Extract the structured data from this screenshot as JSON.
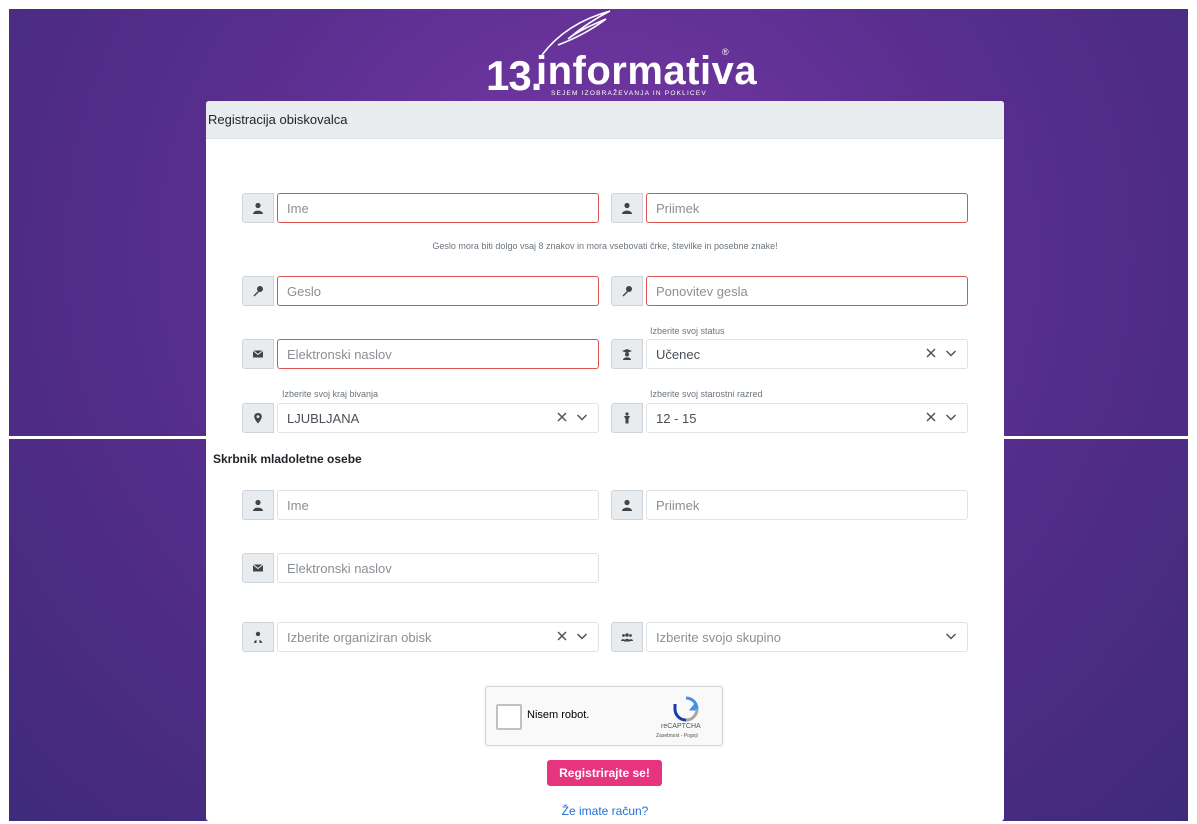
{
  "brand": {
    "number": "13.",
    "name": "informativa",
    "tagline": "SEJEM IZOBRAŽEVANJA IN POKLICEV",
    "registered_mark": "®"
  },
  "form": {
    "title": "Registracija obiskovalca",
    "first_name_placeholder": "Ime",
    "last_name_placeholder": "Priimek",
    "password_hint": "Geslo mora biti dolgo vsaj 8 znakov in mora vsebovati črke, številke in posebne znake!",
    "password_placeholder": "Geslo",
    "password_repeat_placeholder": "Ponovitev gesla",
    "email_placeholder": "Elektronski naslov",
    "status_label": "Izberite svoj status",
    "status_value": "Učenec",
    "residence_label": "Izberite svoj kraj bivanja",
    "residence_value": "LJUBLJANA",
    "age_label": "Izberite svoj starostni razred",
    "age_value": "12 - 15"
  },
  "guardian": {
    "title": "Skrbnik mladoletne osebe",
    "first_name_placeholder": "Ime",
    "last_name_placeholder": "Priimek",
    "email_placeholder": "Elektronski naslov",
    "organized_visit_placeholder": "Izberite organiziran obisk",
    "group_placeholder": "Izberite svojo skupino"
  },
  "captcha": {
    "label": "Nisem robot.",
    "brand": "reCAPTCHA",
    "terms": "Zasebnost - Pogoji"
  },
  "actions": {
    "submit_label": "Registrirajte se!",
    "login_link": "Že imate račun?"
  },
  "colors": {
    "accent": "#e6347f",
    "error_border": "#d9534f",
    "link": "#2470d6",
    "background": "#5a2e8f"
  }
}
